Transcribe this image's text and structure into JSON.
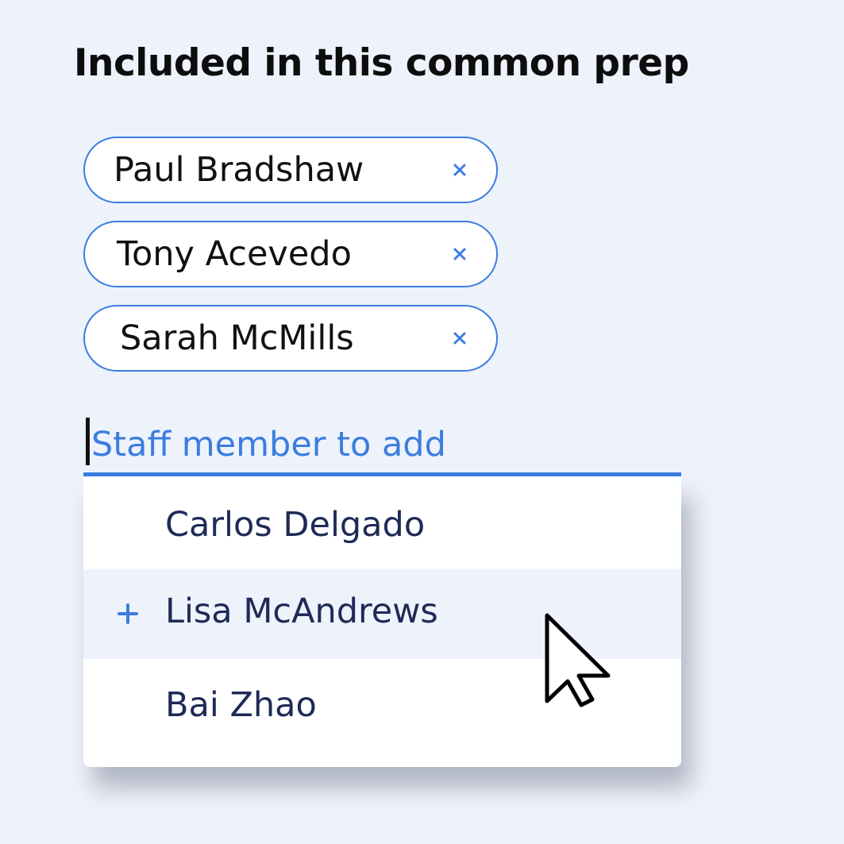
{
  "heading": "Included in this common prep",
  "included": [
    {
      "name": "Paul Bradshaw",
      "remove_icon": "close-icon"
    },
    {
      "name": "Tony Acevedo",
      "remove_icon": "close-icon"
    },
    {
      "name": "Sarah McMills",
      "remove_icon": "close-icon"
    }
  ],
  "search": {
    "value": "",
    "placeholder": "Staff member to add"
  },
  "suggestions": [
    {
      "name": "Carlos Delgado",
      "highlighted": false
    },
    {
      "name": "Lisa McAndrews",
      "highlighted": true,
      "icon": "plus-icon"
    },
    {
      "name": "Bai Zhao",
      "highlighted": false
    }
  ],
  "colors": {
    "accent": "#3b7de0",
    "background": "#eef2fb",
    "option_text": "#1e2a56"
  }
}
